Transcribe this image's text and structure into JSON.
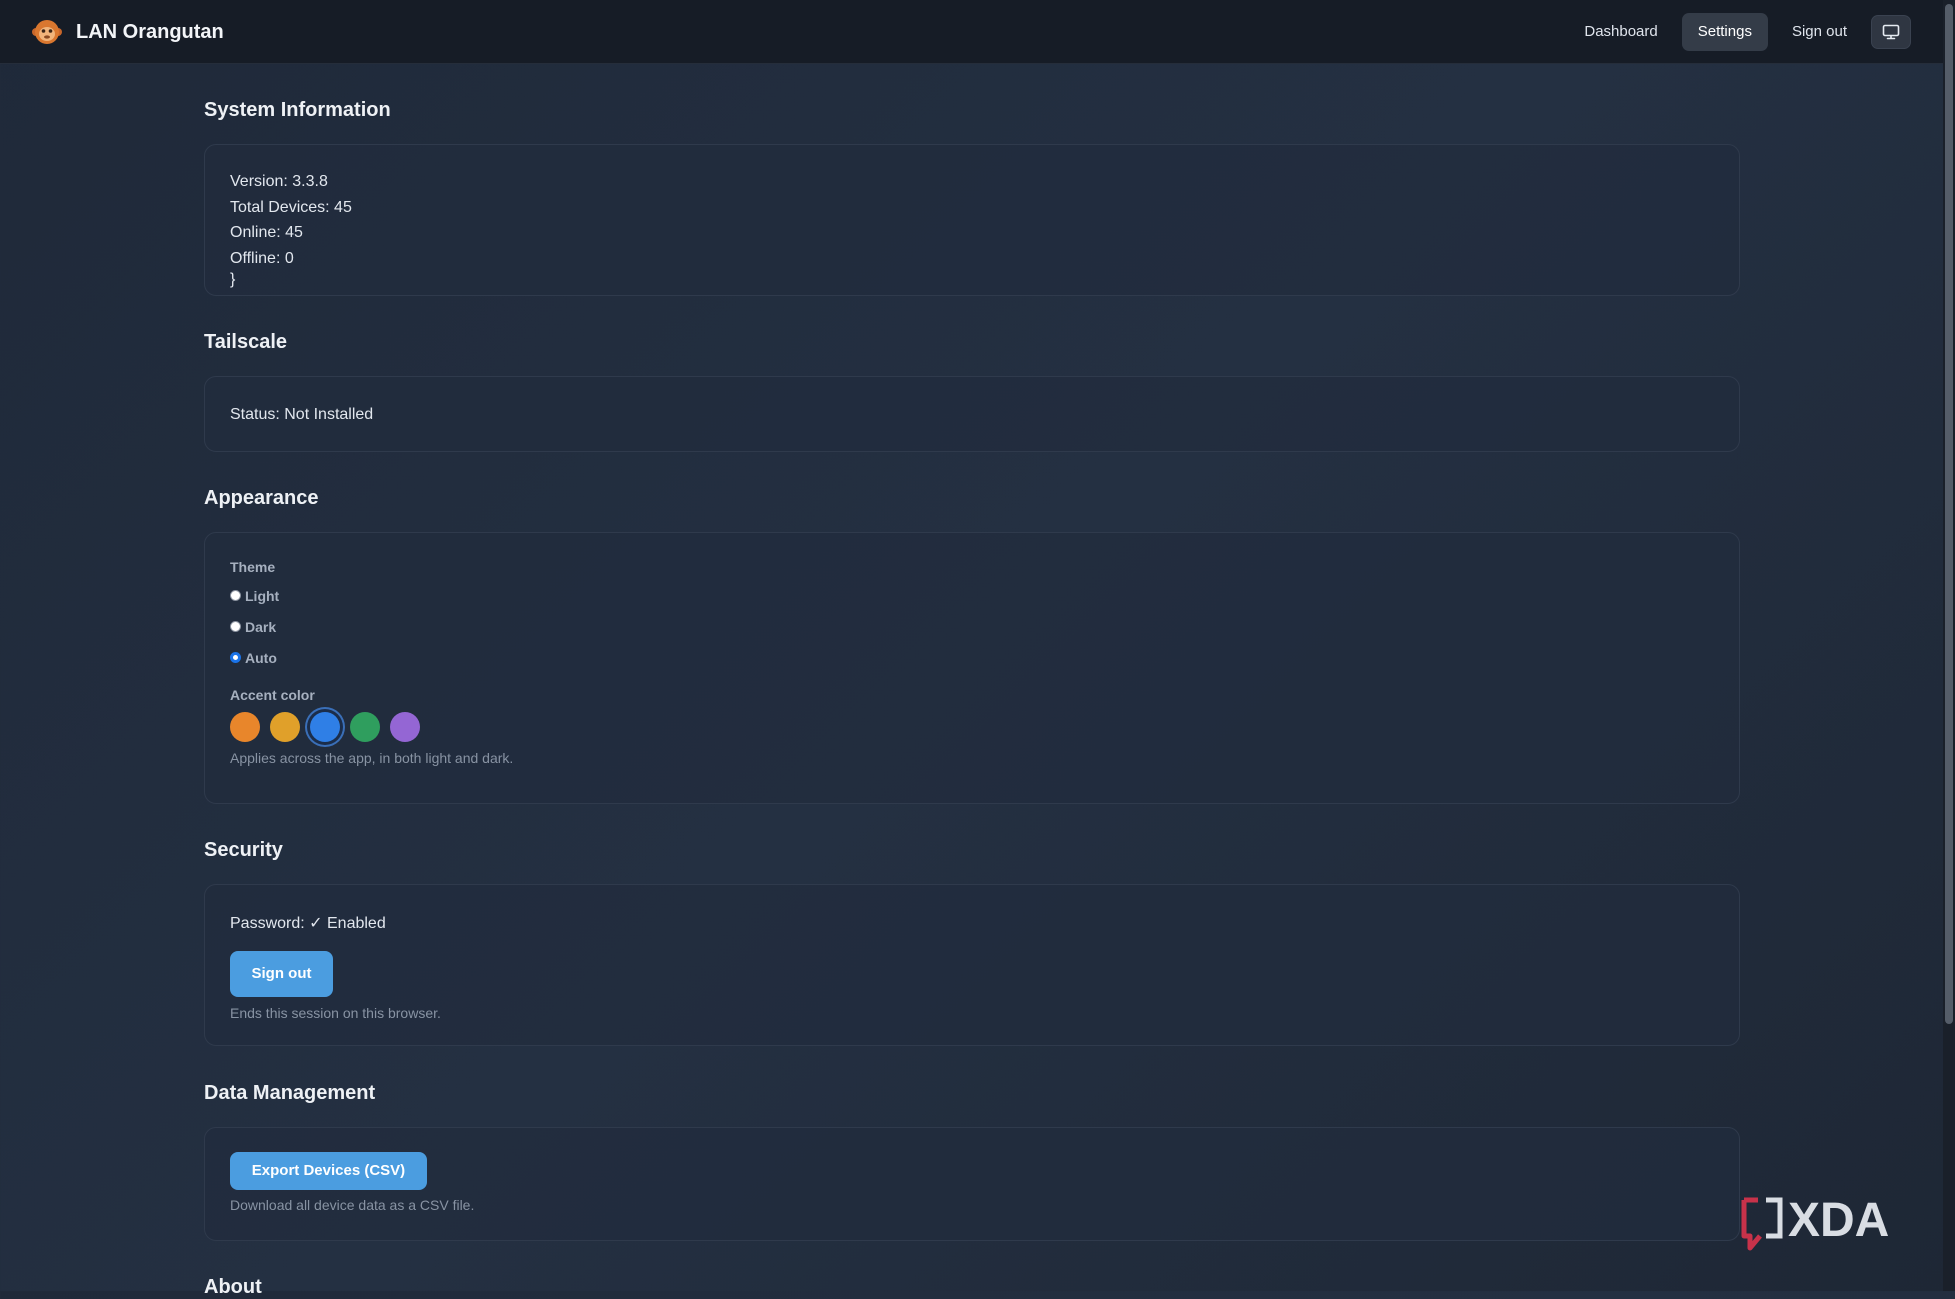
{
  "app": {
    "title": "LAN Orangutan"
  },
  "nav": {
    "items": [
      {
        "label": "Dashboard",
        "active": false
      },
      {
        "label": "Settings",
        "active": true
      },
      {
        "label": "Sign out",
        "active": false
      }
    ],
    "display_icon": "monitor-icon"
  },
  "system_info": {
    "title": "System Information",
    "lines": [
      "Version: 3.3.8",
      "Total Devices: 45",
      "Online: 45",
      "Offline: 0"
    ]
  },
  "tailscale": {
    "title": "Tailscale",
    "status": "Status: Not Installed"
  },
  "appearance": {
    "title": "Appearance",
    "theme_label": "Theme",
    "themes": [
      {
        "label": "Light",
        "checked": false
      },
      {
        "label": "Dark",
        "checked": false
      },
      {
        "label": "Auto",
        "checked": true
      }
    ],
    "accent_label": "Accent color",
    "accent_colors": [
      {
        "name": "orange",
        "hex": "#e8862b",
        "selected": false
      },
      {
        "name": "yellow",
        "hex": "#e0a02a",
        "selected": false
      },
      {
        "name": "blue",
        "hex": "#2f7fe6",
        "selected": true
      },
      {
        "name": "green",
        "hex": "#2f9e5e",
        "selected": false
      },
      {
        "name": "purple",
        "hex": "#9466d4",
        "selected": false
      }
    ],
    "accent_hint": "Applies across the app, in both light and dark."
  },
  "security": {
    "title": "Security",
    "password_status": "Password: ✓ Enabled",
    "signout_label": "Sign out",
    "signout_hint": "Ends this session on this browser."
  },
  "data_management": {
    "title": "Data Management",
    "export_label": "Export Devices (CSV)",
    "export_hint": "Download all device data as a CSV file."
  },
  "about": {
    "title": "About"
  },
  "watermark": {
    "text": "XDA"
  },
  "colors": {
    "background": "#212b3a",
    "topbar": "#161c26",
    "card": "#222c3d",
    "primary_button": "#4b9de0"
  }
}
